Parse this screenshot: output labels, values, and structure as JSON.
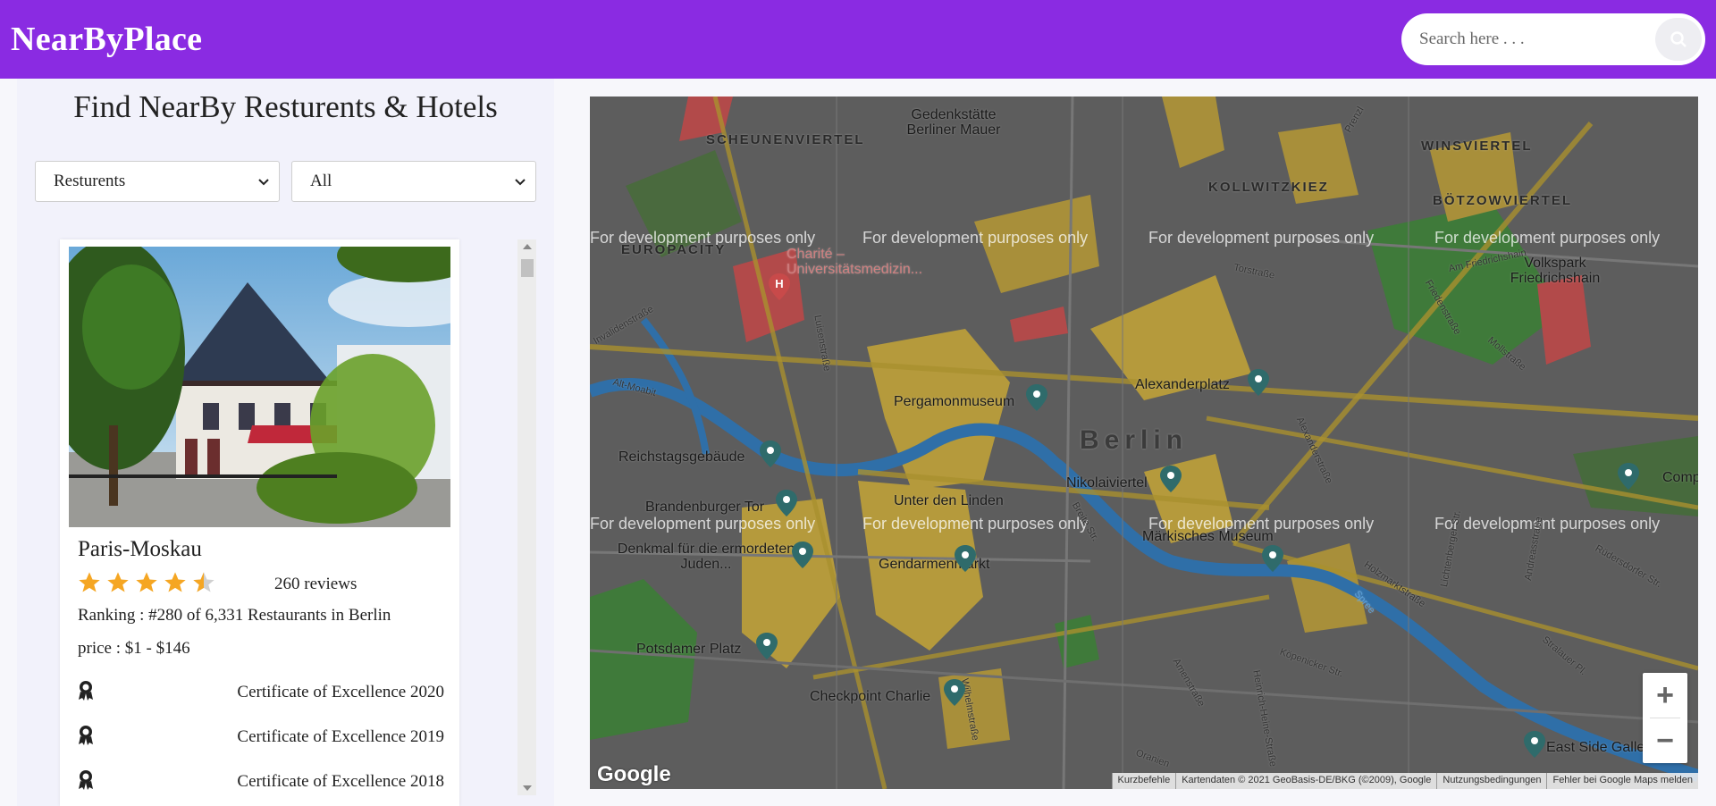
{
  "header": {
    "brand": "NearByPlace",
    "search_placeholder": "Search here . . .",
    "bg_color": "#8a2be2"
  },
  "sidebar": {
    "title": "Find NearBy Resturents & Hotels",
    "type_select": {
      "selected": "Resturents"
    },
    "rating_select": {
      "selected": "All"
    }
  },
  "card": {
    "name": "Paris-Moskau",
    "rating": 4.5,
    "reviews": "260 reviews",
    "ranking": "Ranking :  #280 of 6,331 Restaurants in Berlin",
    "price": "price :  $1 - $146",
    "certificates": [
      {
        "label": "Certificate of Excellence 2020",
        "icon": "award-icon"
      },
      {
        "label": "Certificate of Excellence 2019",
        "icon": "award-icon"
      },
      {
        "label": "Certificate of Excellence 2018",
        "icon": "award-icon"
      }
    ]
  },
  "map": {
    "watermark": "For development purposes only",
    "city": "Berlin",
    "districts": [
      "SCHEUNENVIERTEL",
      "WINSVIERTEL",
      "KOLLWITZKIEZ",
      "BÖTZOWVIERTEL",
      "EUROPACITY"
    ],
    "places": [
      "Gedenkstätte Berliner Mauer",
      "Charité – Universitätsmedizin...",
      "Volkspark Friedrichshain",
      "Pergamonmuseum",
      "Alexanderplatz",
      "Reichstagsgebäude",
      "Nikolaiviertel",
      "Brandenburger Tor",
      "Unter den Linden",
      "Märkisches Museum",
      "Denkmal für die ermordeten Juden...",
      "Gendarmenmarkt",
      "Potsdamer Platz",
      "Checkpoint Charlie",
      "East Side Gallery",
      "Comput"
    ],
    "streets": [
      "Torstraße",
      "Am Friedrichshain",
      "Friedenstraße",
      "Mollstraße",
      "Luisenstraße",
      "Alt-Moabit",
      "Spree",
      "Alexanderstraße",
      "Breite Str.",
      "Holzmarktstraße",
      "Köpenicker Str.",
      "Heinrich-Heine-Straße",
      "Amenstraße",
      "Lichtenberger Str.",
      "Andreasstraße",
      "Rüdersdorfer Str.",
      "Stralauer Pl.",
      "Wilhelmstraße",
      "Invalidenstraße",
      "Prenzl",
      "Oranien"
    ],
    "zoom_in": "+",
    "zoom_out": "−",
    "google_logo": "Google",
    "attribution": [
      "Kurzbefehle",
      "Kartendaten © 2021 GeoBasis-DE/BKG (©2009), Google",
      "Nutzungsbedingungen",
      "Fehler bei Google Maps melden"
    ]
  }
}
